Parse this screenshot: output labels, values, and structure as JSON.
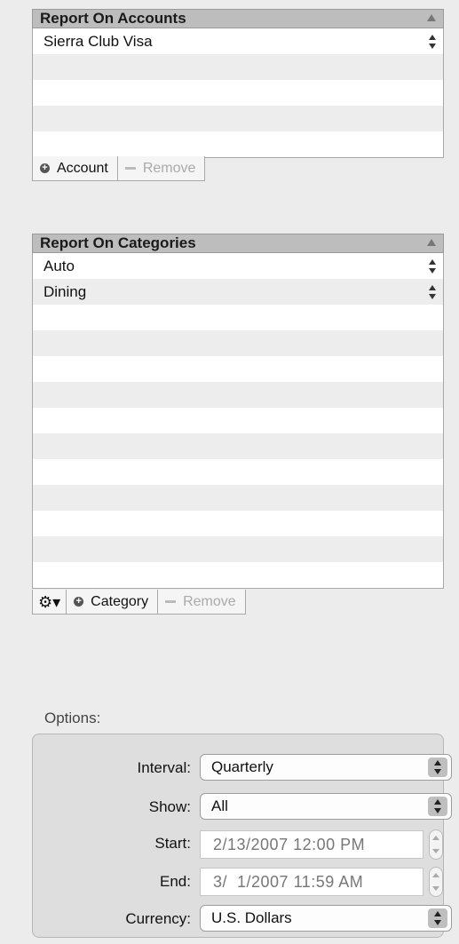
{
  "accounts": {
    "header": "Report On Accounts",
    "items": [
      "Sierra Club Visa"
    ],
    "add_label": "Account",
    "remove_label": "Remove"
  },
  "categories": {
    "header": "Report On Categories",
    "items": [
      "Auto",
      "Dining"
    ],
    "gear_icon": "gear-icon",
    "add_label": "Category",
    "remove_label": "Remove"
  },
  "options": {
    "label": "Options:",
    "interval_label": "Interval:",
    "interval_value": "Quarterly",
    "show_label": "Show:",
    "show_value": "All",
    "start_label": "Start:",
    "start_value": "2/13/2007 12:00 PM",
    "end_label": "End:",
    "end_value": "3/  1/2007 11:59 AM",
    "currency_label": "Currency:",
    "currency_value": "U.S. Dollars"
  }
}
